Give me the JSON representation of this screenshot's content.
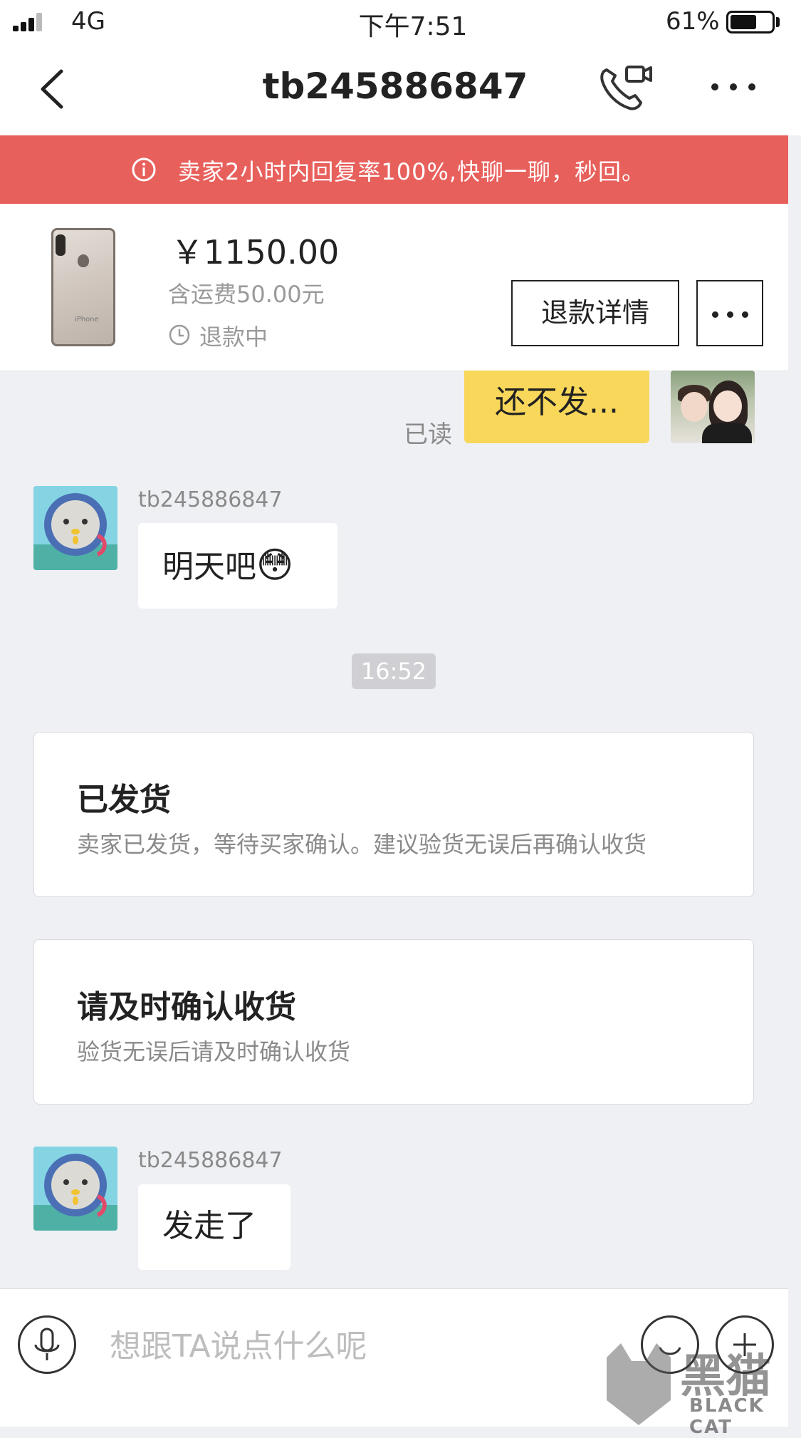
{
  "status_bar": {
    "network": "4G",
    "time": "下午7:51",
    "battery": "61%",
    "battery_level": 0.61
  },
  "nav": {
    "title": "tb245886847",
    "back_icon": "chevron-left-icon",
    "call_icon": "phone-video-icon",
    "more_icon": "more-dots-icon"
  },
  "banner": {
    "text": "卖家2小时内回复率100%,快聊一聊，秒回。",
    "color": "#e8605c"
  },
  "product": {
    "price": "￥1150.00",
    "shipping": "含运费50.00元",
    "status": "退款中",
    "refund_button": "退款详情"
  },
  "messages": {
    "read_label": "已读",
    "my_message": "还不发...",
    "msg1": {
      "sender": "tb245886847",
      "text": "明天吧",
      "emoji": "😳"
    },
    "time": "16:52",
    "card1": {
      "title": "已发货",
      "desc": "卖家已发货，等待买家确认。建议验货无误后再确认收货"
    },
    "card2": {
      "title": "请及时确认收货",
      "desc": "验货无误后请及时确认收货"
    },
    "msg2": {
      "sender": "tb245886847",
      "text": "发走了"
    }
  },
  "input": {
    "placeholder": "想跟TA说点什么呢"
  },
  "watermark": {
    "text": "黑猫",
    "sub": "BLACK CAT"
  },
  "colors": {
    "accent_yellow": "#f8d75a",
    "banner_red": "#e8605c",
    "background": "#eff0f4"
  }
}
